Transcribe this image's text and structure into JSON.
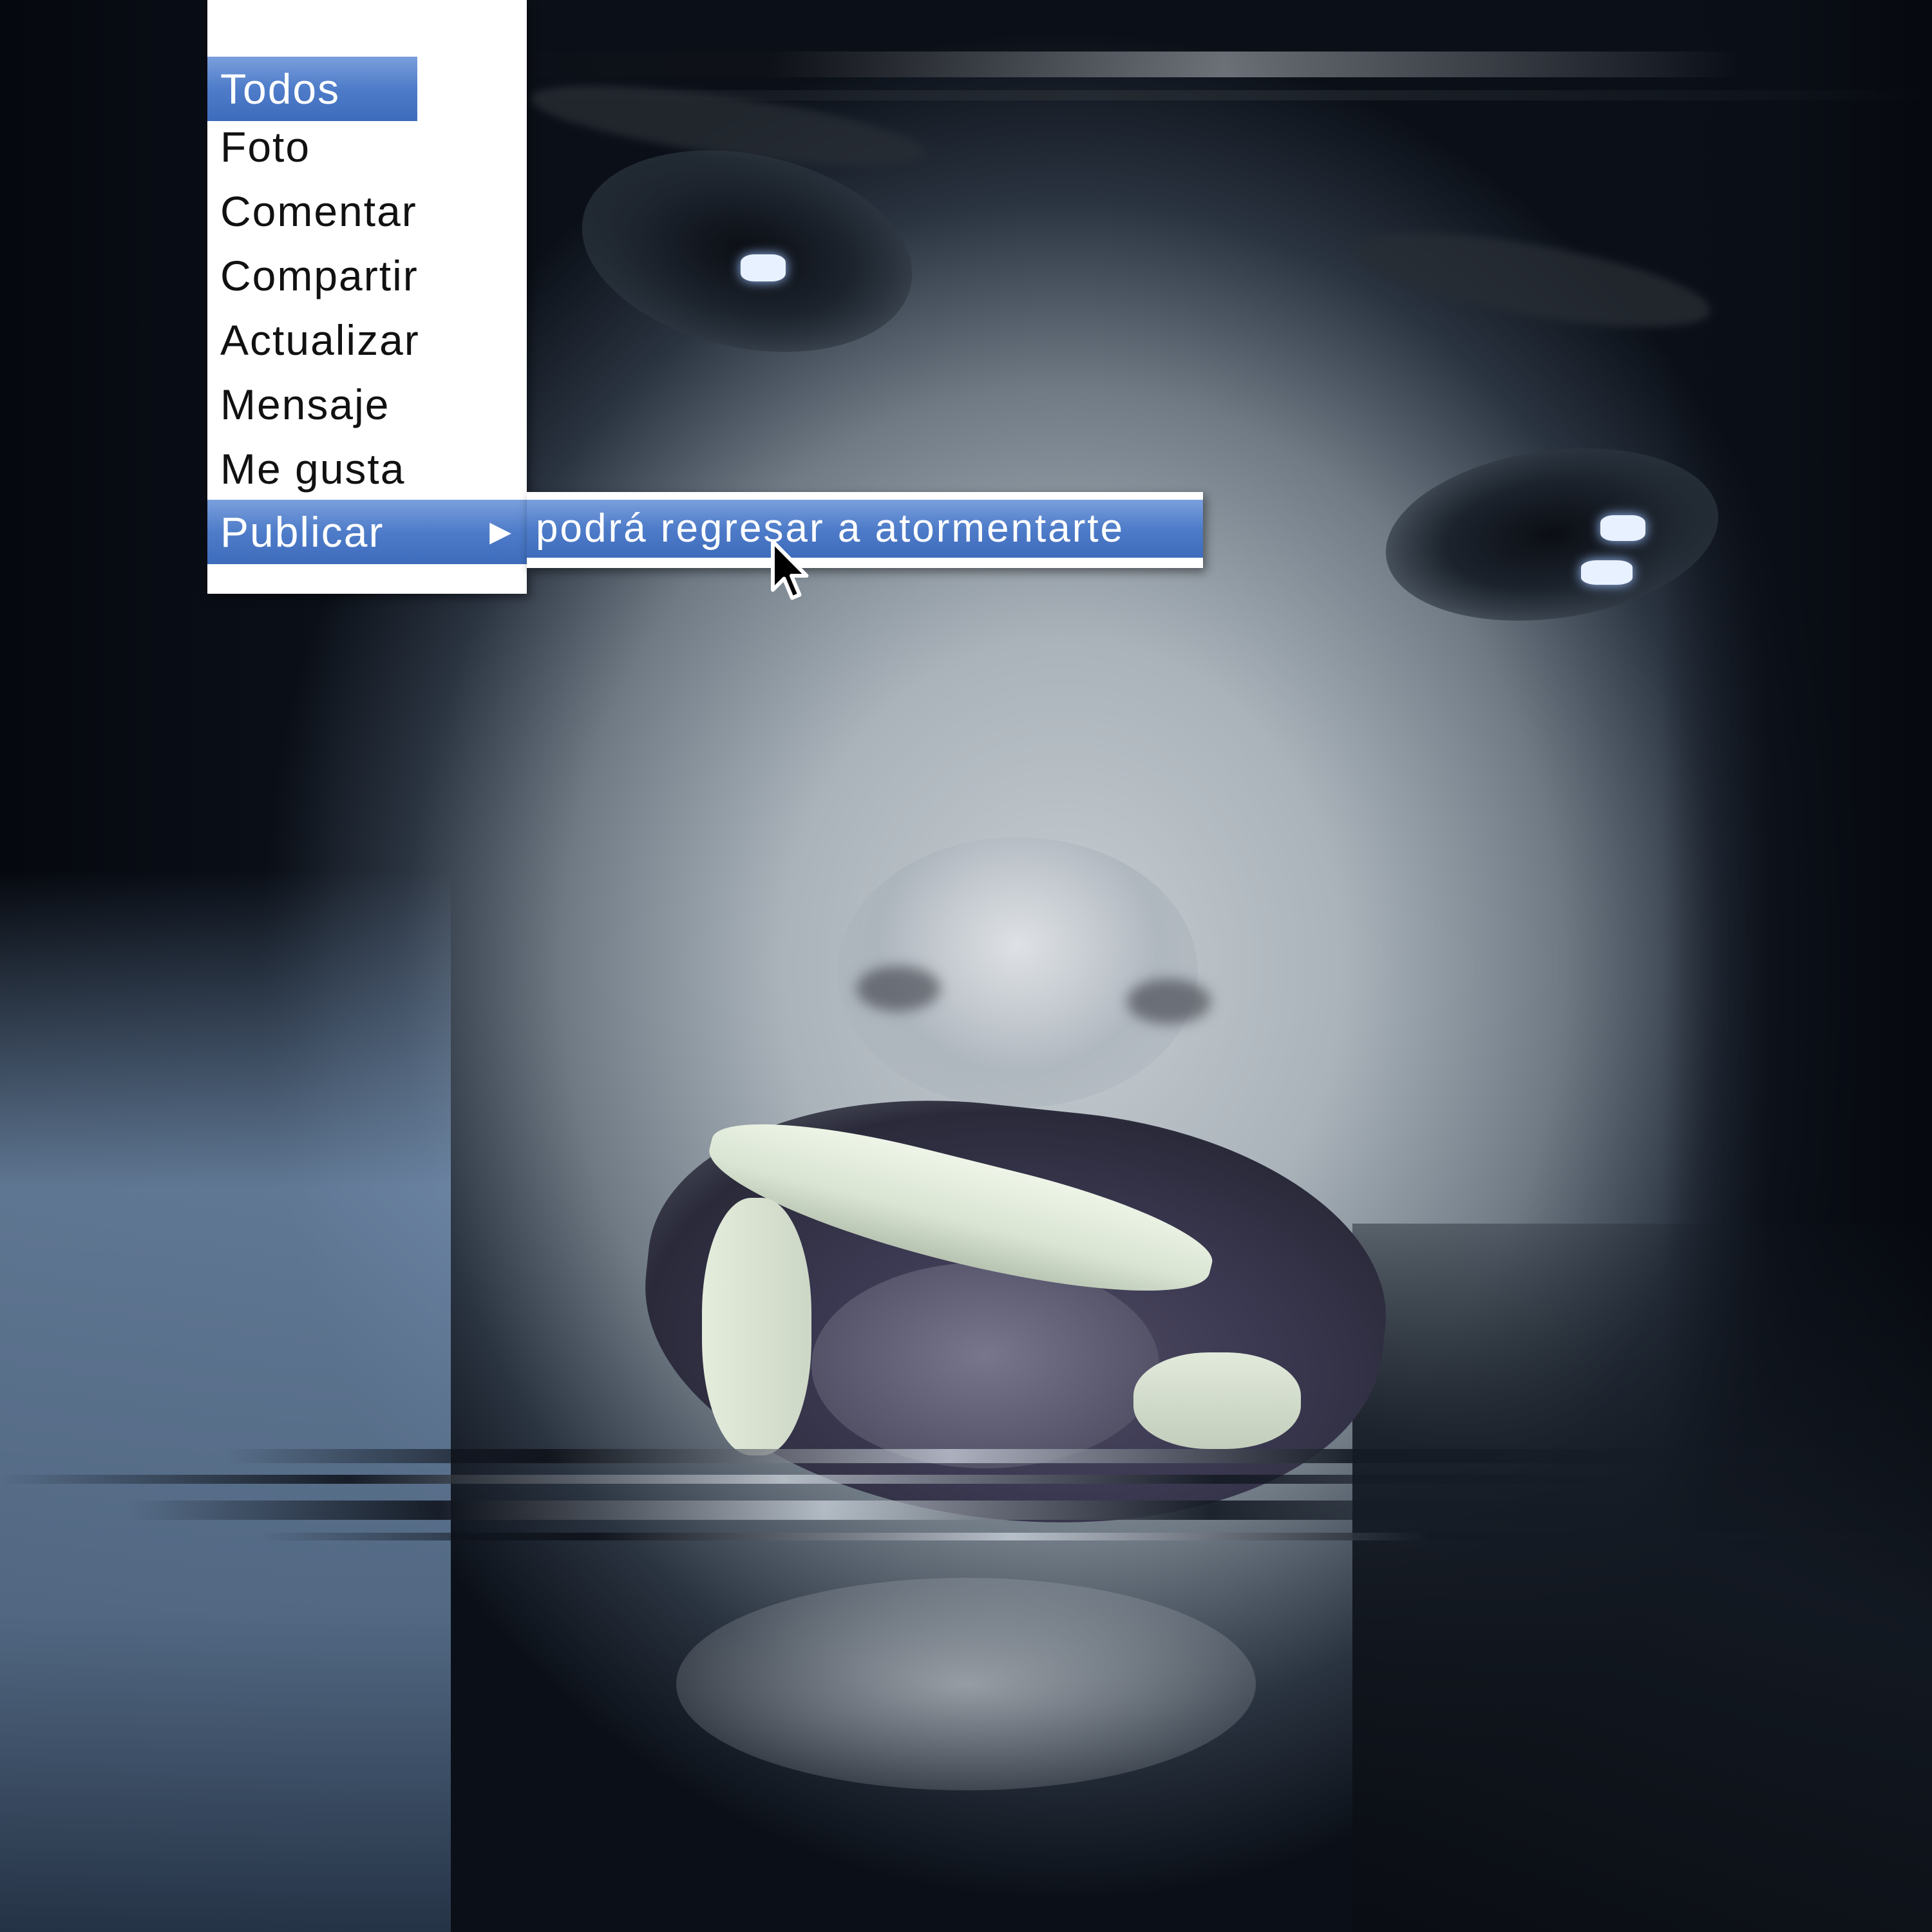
{
  "context_menu": {
    "items": [
      {
        "label": "Todos",
        "highlighted": true
      },
      {
        "label": "Foto",
        "highlighted": false
      },
      {
        "label": "Comentar",
        "highlighted": false
      },
      {
        "label": "Compartir",
        "highlighted": false
      },
      {
        "label": "Actualizar",
        "highlighted": false
      },
      {
        "label": "Mensaje",
        "highlighted": false
      },
      {
        "label": "Me gusta",
        "highlighted": false
      },
      {
        "label": "Publicar",
        "highlighted": true,
        "has_submenu": true,
        "submenu_arrow_icon": "triangle-right-icon"
      }
    ],
    "highlight_color": "#4e7cc9"
  },
  "submenu": {
    "items": [
      {
        "label": "podrá regresar a atormentarte",
        "highlighted": true
      }
    ]
  },
  "cursor": {
    "icon": "arrow-cursor-icon"
  },
  "background": {
    "description_color_tone": "#aab3ba"
  }
}
